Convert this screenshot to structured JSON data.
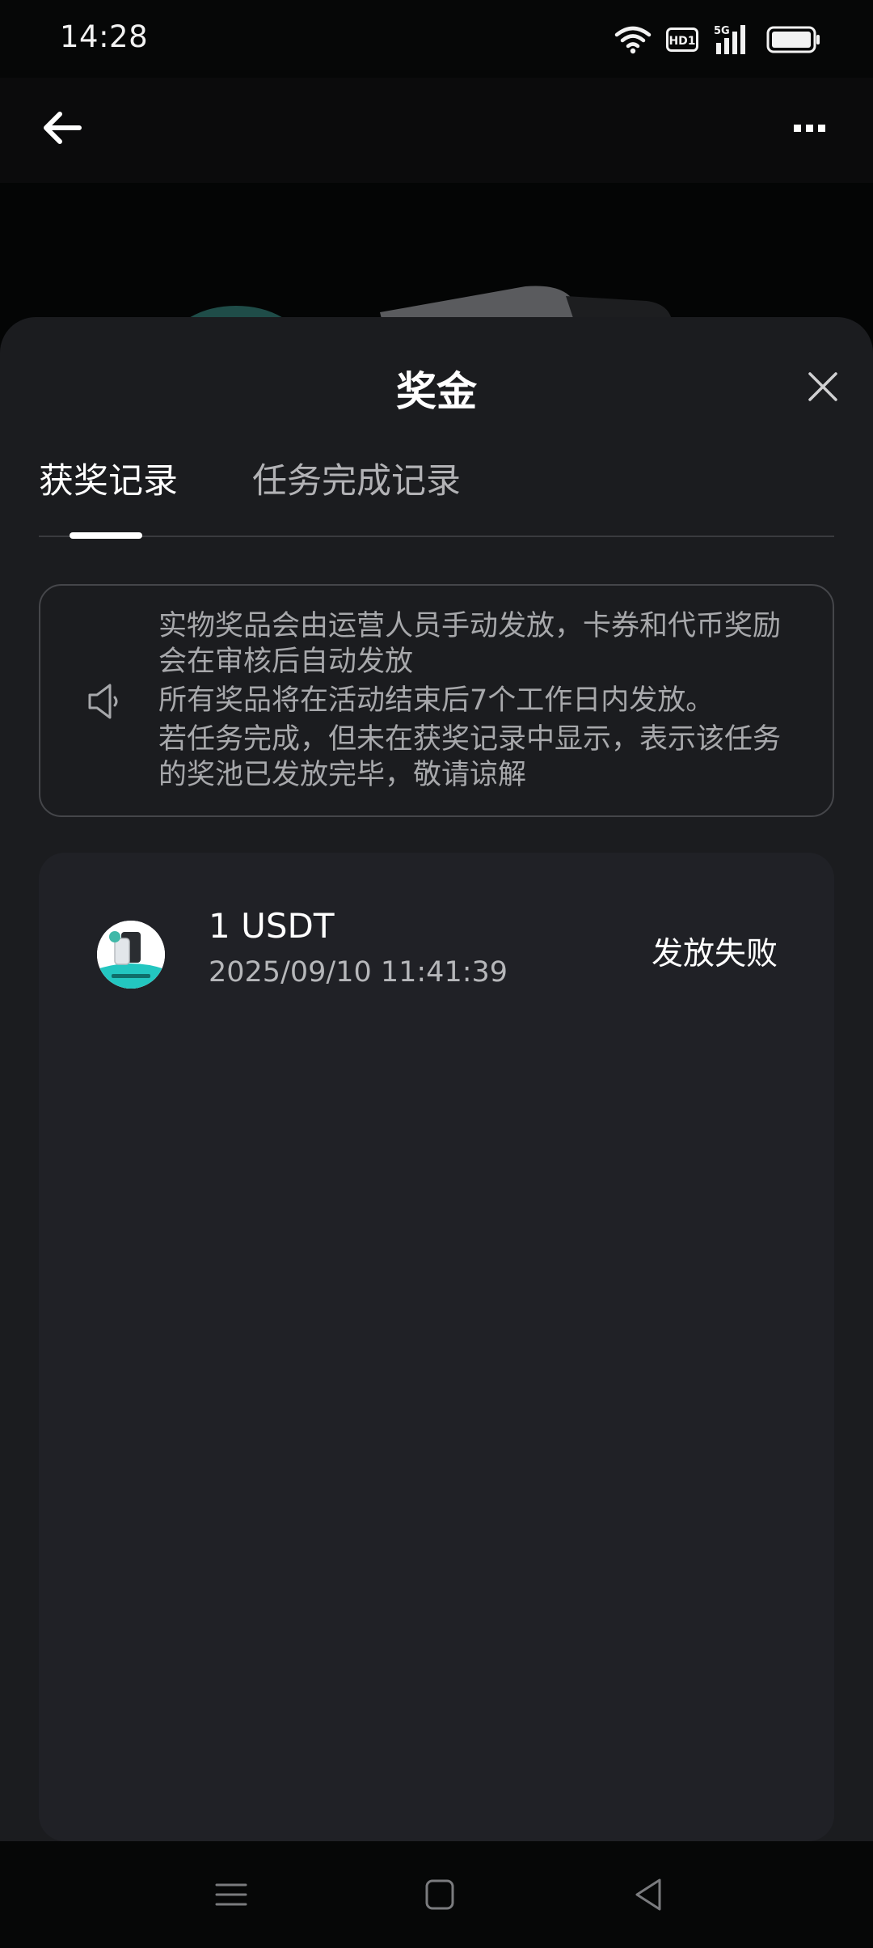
{
  "status_bar": {
    "time": "14:28",
    "icons": [
      "wifi-icon",
      "hd-icon",
      "signal-5g-icon",
      "battery-icon"
    ],
    "hd_label": "HD1",
    "network_label": "5G"
  },
  "app_bar": {
    "back_icon": "arrow-left-icon",
    "more_icon": "more-dots-icon"
  },
  "sheet": {
    "title": "奖金",
    "close_icon": "close-icon",
    "tabs": [
      {
        "label": "获奖记录",
        "active": true
      },
      {
        "label": "任务完成记录",
        "active": false
      }
    ],
    "notice": {
      "icon": "speaker-icon",
      "lines": [
        "实物奖品会由运营人员手动发放，卡券和代币奖励会在审核后自动发放",
        "所有奖品将在活动结束后7个工作日内发放。",
        "若任务完成，但未在获奖记录中显示，表示该任务的奖池已发放完毕，敬请谅解"
      ]
    },
    "records": [
      {
        "title": "1 USDT",
        "time": "2025/09/10 11:41:39",
        "status": "发放失败"
      }
    ]
  },
  "nav_bar": {
    "icons": [
      "menu-icon",
      "home-icon",
      "back-triangle-icon"
    ]
  },
  "colors": {
    "background": "#060707",
    "sheet": "#1b1c1f",
    "card": "#202126",
    "text_primary": "#ffffff",
    "text_secondary": "#a7a8ab"
  }
}
